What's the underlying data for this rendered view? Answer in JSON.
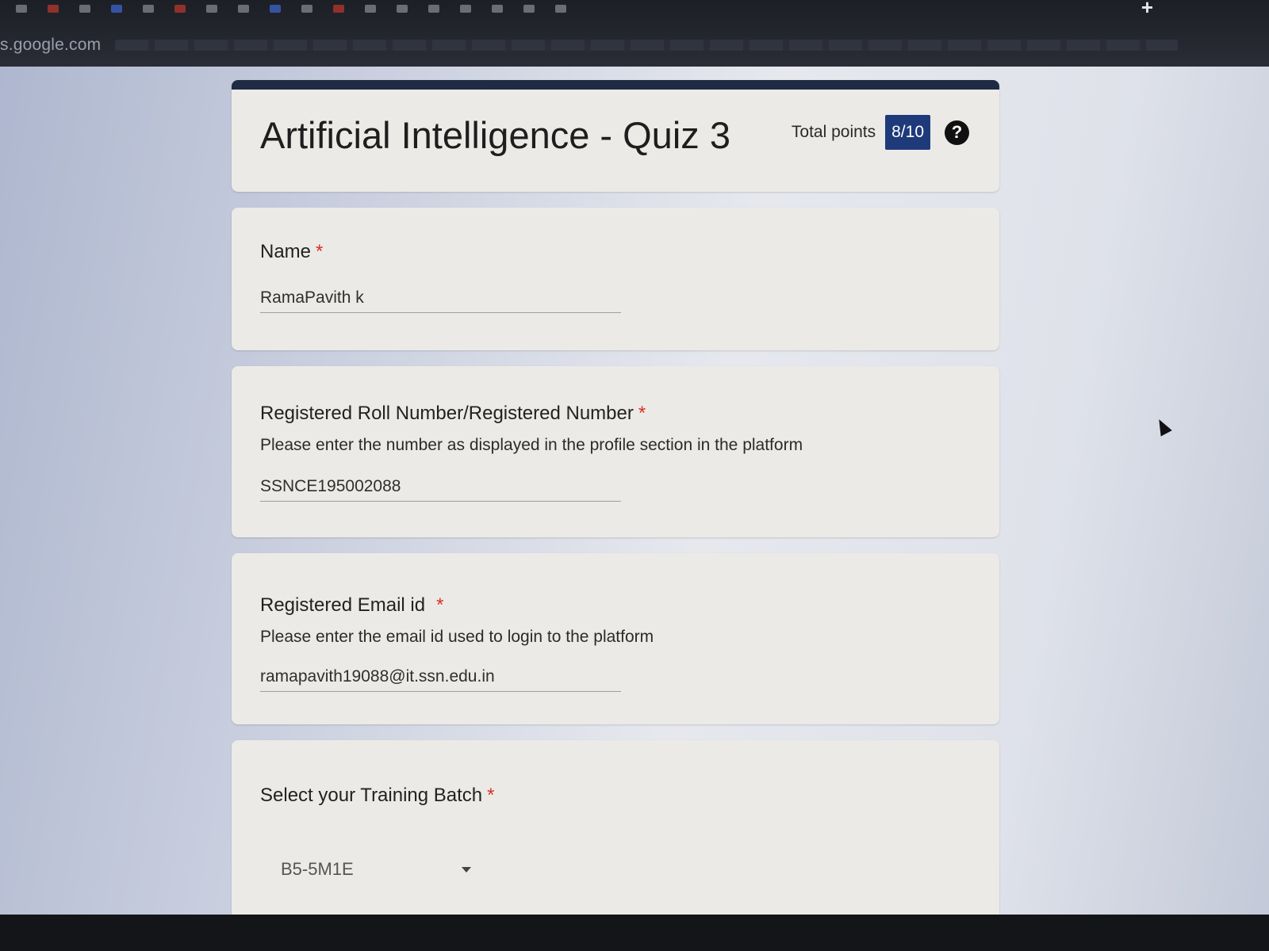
{
  "browser": {
    "domain": "s.google.com",
    "new_tab_symbol": "+"
  },
  "form": {
    "title": "Artificial Intelligence - Quiz 3",
    "total_points_label": "Total points",
    "total_points_value": "8/10",
    "help_symbol": "?"
  },
  "questions": [
    {
      "label": "Name",
      "required_mark": "*",
      "description": "",
      "value": "RamaPavith k"
    },
    {
      "label": "Registered Roll Number/Registered Number",
      "required_mark": "*",
      "description": "Please enter the number as displayed in the profile section in the platform",
      "value": "SSNCE195002088"
    },
    {
      "label": "Registered Email id",
      "required_mark": "*",
      "description": "Please enter the email id used to login to the platform",
      "value": "ramapavith19088@it.ssn.edu.in"
    },
    {
      "label": "Select your Training Batch",
      "required_mark": "*",
      "description": "",
      "value": "B5-5M1E"
    }
  ],
  "colors": {
    "accent": "#1f2a44",
    "badge": "#1f3a7a",
    "required": "#d93025"
  }
}
